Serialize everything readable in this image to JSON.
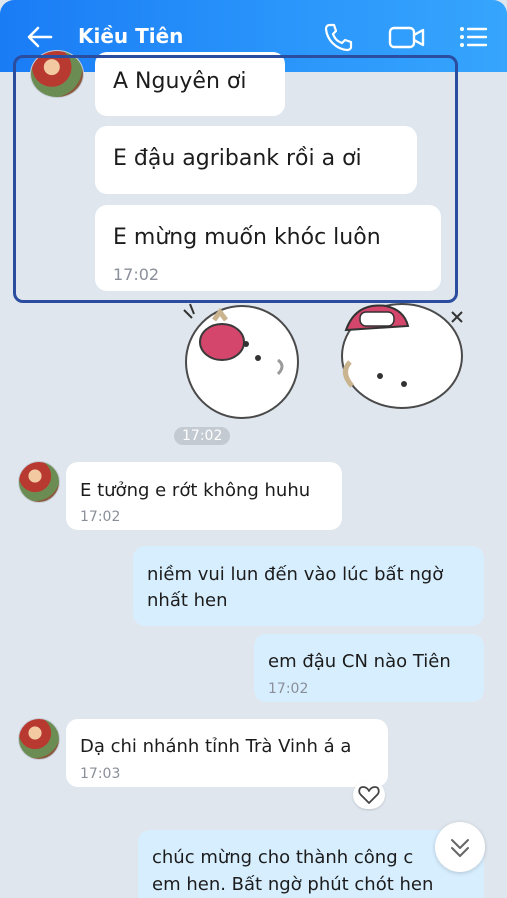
{
  "header": {
    "title": "Kiều Tiên",
    "icons": [
      "back-arrow-icon",
      "phone-icon",
      "video-call-icon",
      "menu-list-icon"
    ],
    "color": "#1a7cf5"
  },
  "messages": [
    {
      "text": "A Nguyên ơi"
    },
    {
      "text": "E đậu agribank rồi a ơi"
    },
    {
      "text": "E mừng muốn khóc luôn",
      "time": "17:02"
    },
    {
      "sticker_time": "17:02"
    },
    {
      "text": "E tưởng e rớt không huhu",
      "time": "17:02"
    },
    {
      "text_line1": "niềm vui lun đến vào lúc bất ngờ",
      "text_line2": "nhất hen"
    },
    {
      "text": "em đậu CN nào Tiên",
      "time": "17:02"
    },
    {
      "text": "Dạ chi nhánh tỉnh Trà Vinh á a",
      "time": "17:03"
    },
    {
      "text_line1": "chúc mừng cho thành công c",
      "text_line2": "em hen. Bất ngờ phút chót hen"
    }
  ]
}
